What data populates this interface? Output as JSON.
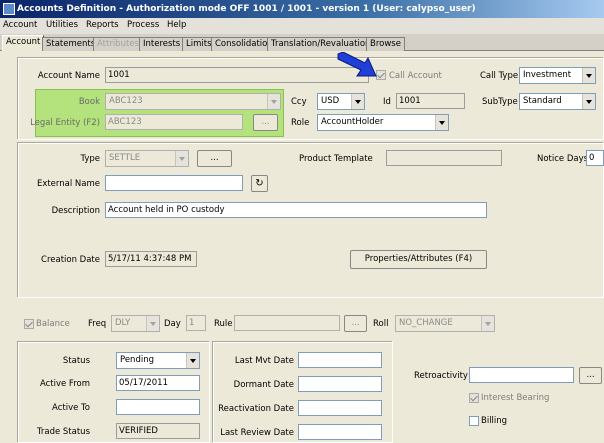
{
  "window": {
    "title": "Accounts Definition - Authorization mode OFF 1001 / 1001 - version 1 (User: calypso_user)"
  },
  "menu": [
    "Account",
    "Utilities",
    "Reports",
    "Process",
    "Help"
  ],
  "tabs": [
    "Account",
    "Statements",
    "Attributes",
    "Interests",
    "Limits",
    "Consolidation",
    "Translation/Revaluation",
    "Browse"
  ],
  "account": {
    "name_label": "Account Name",
    "name_value": "1001",
    "call_account_label": "Call Account",
    "call_type_label": "Call Type",
    "call_type_value": "Investment",
    "book_label": "Book",
    "book_value": "ABC123",
    "ccy_label": "Ccy",
    "ccy_value": "USD",
    "id_label": "Id",
    "id_value": "1001",
    "subtype_label": "SubType",
    "subtype_value": "Standard",
    "legal_entity_label": "Legal Entity (F2)",
    "legal_entity_value": "ABC123",
    "ellipsis": "...",
    "role_label": "Role",
    "role_value": "AccountHolder"
  },
  "details": {
    "type_label": "Type",
    "type_value": "SETTLE",
    "product_template_label": "Product Template",
    "product_template_value": "",
    "notice_days_label": "Notice Days",
    "notice_days_value": "0",
    "external_name_label": "External Name",
    "external_name_value": "",
    "refresh_icon": "↻",
    "description_label": "Description",
    "description_value": "Account held in PO custody",
    "creation_date_label": "Creation Date",
    "creation_date_value": "5/17/11 4:37:48 PM",
    "properties_button": "Properties/Attributes (F4)"
  },
  "balance": {
    "balance_label": "Balance",
    "freq_label": "Freq",
    "freq_value": "DLY",
    "day_label": "Day",
    "day_value": "1",
    "rule_label": "Rule",
    "rule_value": "",
    "roll_label": "Roll",
    "roll_value": "NO_CHANGE"
  },
  "status": {
    "status_label": "Status",
    "status_value": "Pending",
    "active_from_label": "Active From",
    "active_from_value": "05/17/2011",
    "active_to_label": "Active To",
    "active_to_value": "",
    "trade_status_label": "Trade Status",
    "trade_status_value": "VERIFIED"
  },
  "dates": {
    "last_mvt_label": "Last Mvt Date",
    "dormant_label": "Dormant Date",
    "reactivation_label": "Reactivation Date",
    "last_review_label": "Last Review Date"
  },
  "retro": {
    "retroactivity_label": "Retroactivity",
    "retroactivity_value": "",
    "interest_bearing_label": "Interest Bearing",
    "billing_label": "Billing"
  },
  "colors": {
    "highlight": "#b4e37e",
    "arrow": "#1f3fd6"
  }
}
